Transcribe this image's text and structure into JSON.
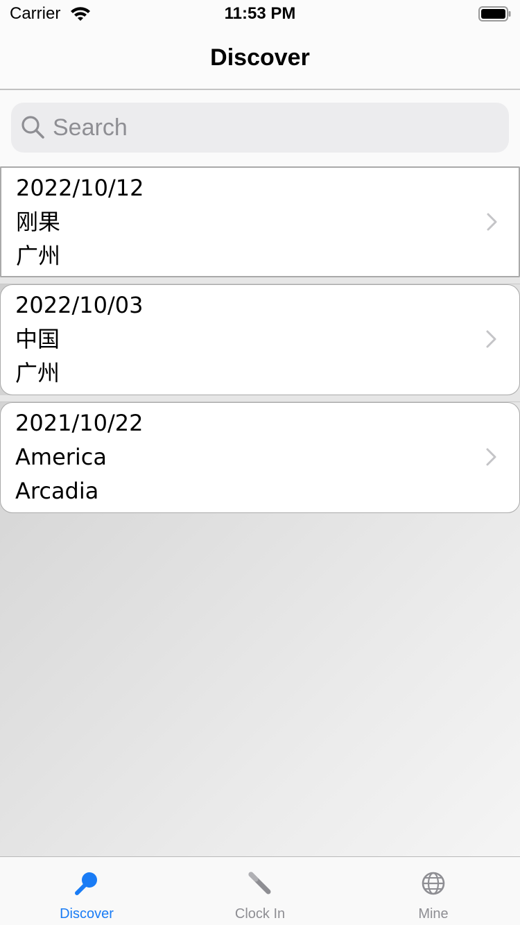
{
  "status_bar": {
    "carrier": "Carrier",
    "time": "11:53 PM"
  },
  "nav": {
    "title": "Discover"
  },
  "search": {
    "placeholder": "Search",
    "value": ""
  },
  "records": [
    {
      "date": "2022/10/12",
      "name": "刚果",
      "city": "广州"
    },
    {
      "date": "2022/10/03",
      "name": "中国",
      "city": "广州"
    },
    {
      "date": "2021/10/22",
      "name": "America",
      "city": "Arcadia"
    }
  ],
  "tabs": [
    {
      "label": "Discover",
      "icon": "discover-icon",
      "active": true
    },
    {
      "label": "Clock In",
      "icon": "clock-in-icon",
      "active": false
    },
    {
      "label": "Mine",
      "icon": "globe-icon",
      "active": false
    }
  ],
  "colors": {
    "accent": "#1a7cf5",
    "inactive": "#8e8e93"
  }
}
